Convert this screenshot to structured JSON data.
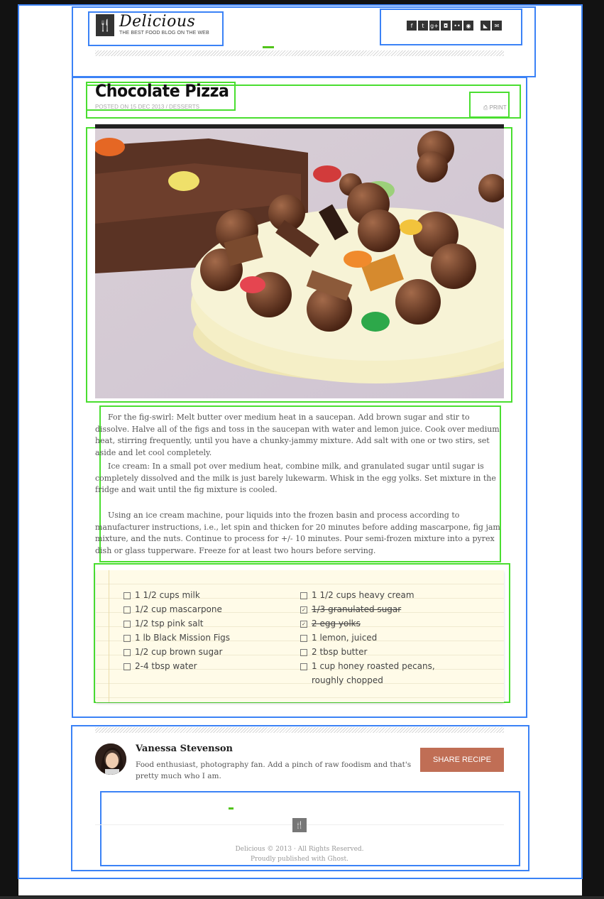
{
  "header": {
    "logo_icon": "fork-knife-icon",
    "site_title": "Delicious",
    "tagline": "THE BEST FOOD BLOG ON THE WEB",
    "social_icons": [
      "facebook-icon",
      "twitter-icon",
      "google-plus-icon",
      "instagram-icon",
      "flickr-icon",
      "camera-icon",
      "rss-icon",
      "email-icon"
    ]
  },
  "post": {
    "title": "Chocolate Pizza",
    "meta": "POSTED ON 15 DEC 2013 / DESSERTS",
    "print_label": "PRINT",
    "print_icon": "printer-icon",
    "paragraphs": [
      "For the fig-swirl: Melt butter over medium heat in a saucepan. Add brown sugar and stir to dissolve. Halve all of the figs and toss in the saucepan with water and lemon juice. Cook over medium heat, stirring frequently, until you have a chunky-jammy mixture. Add salt with one or two stirs, set aside and let cool completely.",
      "Ice cream: In a small pot over medium heat, combine milk, and granulated sugar until sugar is completely dissolved and the milk is just barely lukewarm. Whisk in the egg yolks. Set mixture in the fridge and wait until the fig mixture is cooled.",
      "Using an ice cream machine, pour liquids into the frozen basin and process according to manufacturer instructions, i.e., let spin and thicken for 20 minutes before adding mascarpone, fig jam mixture, and the nuts. Continue to process for +/- 10 minutes. Pour semi-frozen mixture into a pyrex dish or glass tupperware. Freeze for at least two hours before serving."
    ]
  },
  "ingredients": {
    "left": [
      {
        "text": "1 1/2 cups milk",
        "checked": false
      },
      {
        "text": "1/2 cup mascarpone",
        "checked": false
      },
      {
        "text": "1/2 tsp pink salt",
        "checked": false
      },
      {
        "text": "1 lb Black Mission Figs",
        "checked": false
      },
      {
        "text": "1/2 cup brown sugar",
        "checked": false
      },
      {
        "text": "2-4 tbsp water",
        "checked": false
      }
    ],
    "right": [
      {
        "text": "1 1/2 cups heavy cream",
        "checked": false
      },
      {
        "text": "1/3 granulated sugar",
        "checked": true
      },
      {
        "text": "2 egg yolks",
        "checked": true
      },
      {
        "text": "1 lemon, juiced",
        "checked": false
      },
      {
        "text": "2 tbsp butter",
        "checked": false
      },
      {
        "text": "1 cup honey roasted pecans, roughly chopped",
        "checked": false
      }
    ]
  },
  "author": {
    "name": "Vanessa Stevenson",
    "bio": "Food enthusiast, photography fan. Add a pinch of raw foodism and that's pretty much who I am.",
    "share_label": "SHARE RECIPE",
    "share_color": "#c06e55"
  },
  "footer": {
    "logo_icon": "fork-knife-icon",
    "copyright": "Delicious © 2013 · All Rights Reserved.",
    "powered": "Proudly published with Ghost."
  }
}
